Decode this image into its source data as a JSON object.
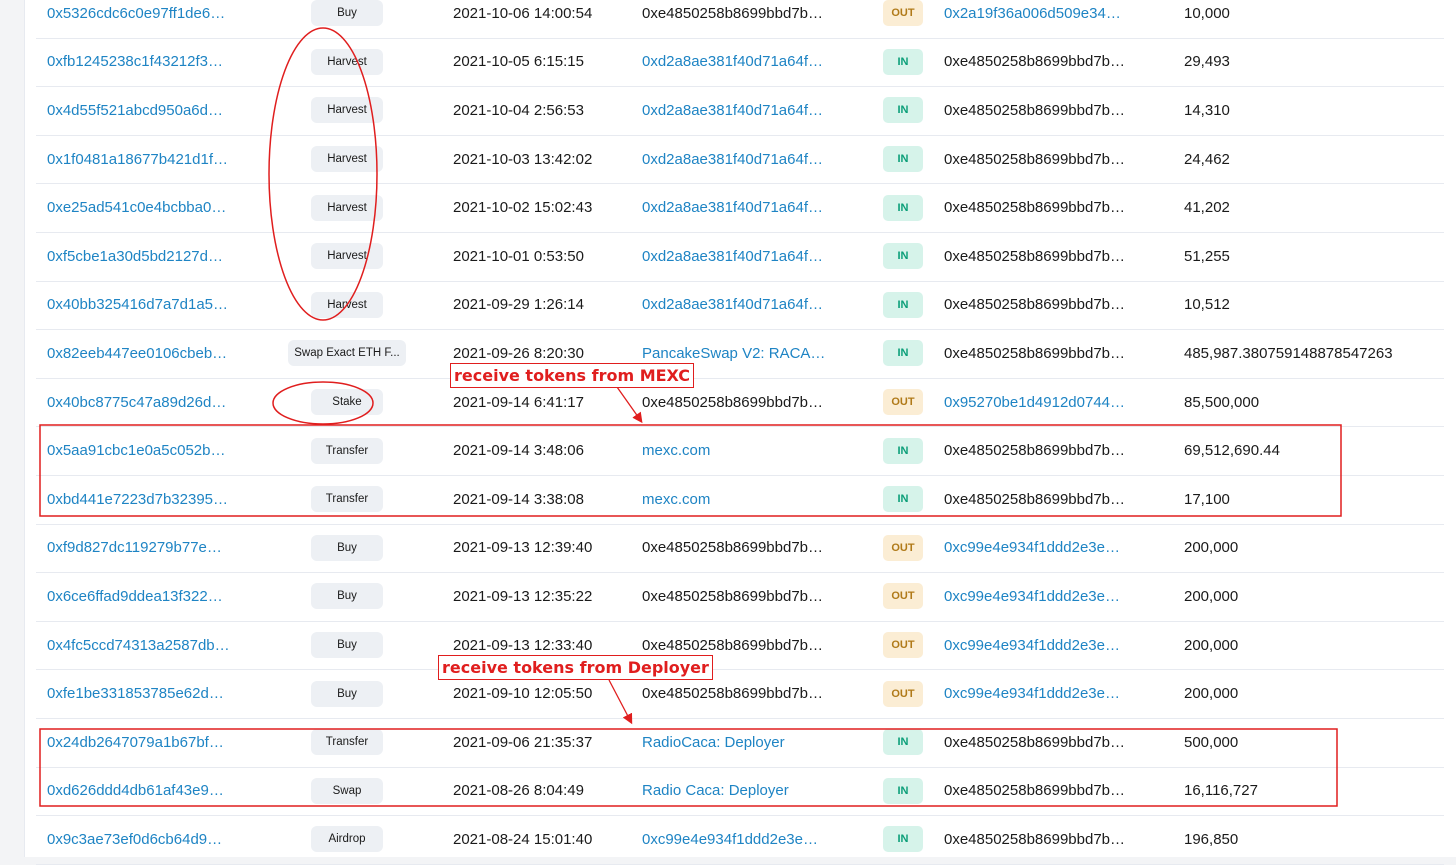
{
  "rows": [
    {
      "hash": "0x5326cdc6c0e97ff1de6…",
      "method": "Buy",
      "time": "2021-10-06 14:00:54",
      "from": "0xe4850258b8699bbd7b…",
      "from_link": false,
      "dir": "OUT",
      "to": "0x2a19f36a006d509e34…",
      "to_link": true,
      "amount": "10,000"
    },
    {
      "hash": "0xfb1245238c1f43212f3…",
      "method": "Harvest",
      "time": "2021-10-05 6:15:15",
      "from": "0xd2a8ae381f40d71a64f…",
      "from_link": true,
      "dir": "IN",
      "to": "0xe4850258b8699bbd7b…",
      "to_link": false,
      "amount": "29,493"
    },
    {
      "hash": "0x4d55f521abcd950a6d…",
      "method": "Harvest",
      "time": "2021-10-04 2:56:53",
      "from": "0xd2a8ae381f40d71a64f…",
      "from_link": true,
      "dir": "IN",
      "to": "0xe4850258b8699bbd7b…",
      "to_link": false,
      "amount": "14,310"
    },
    {
      "hash": "0x1f0481a18677b421d1f…",
      "method": "Harvest",
      "time": "2021-10-03 13:42:02",
      "from": "0xd2a8ae381f40d71a64f…",
      "from_link": true,
      "dir": "IN",
      "to": "0xe4850258b8699bbd7b…",
      "to_link": false,
      "amount": "24,462"
    },
    {
      "hash": "0xe25ad541c0e4bcbba0…",
      "method": "Harvest",
      "time": "2021-10-02 15:02:43",
      "from": "0xd2a8ae381f40d71a64f…",
      "from_link": true,
      "dir": "IN",
      "to": "0xe4850258b8699bbd7b…",
      "to_link": false,
      "amount": "41,202"
    },
    {
      "hash": "0xf5cbe1a30d5bd2127d…",
      "method": "Harvest",
      "time": "2021-10-01 0:53:50",
      "from": "0xd2a8ae381f40d71a64f…",
      "from_link": true,
      "dir": "IN",
      "to": "0xe4850258b8699bbd7b…",
      "to_link": false,
      "amount": "51,255"
    },
    {
      "hash": "0x40bb325416d7a7d1a5…",
      "method": "Harvest",
      "time": "2021-09-29 1:26:14",
      "from": "0xd2a8ae381f40d71a64f…",
      "from_link": true,
      "dir": "IN",
      "to": "0xe4850258b8699bbd7b…",
      "to_link": false,
      "amount": "10,512"
    },
    {
      "hash": "0x82eeb447ee0106cbeb…",
      "method": "Swap Exact ETH F...",
      "time": "2021-09-26 8:20:30",
      "from": "PancakeSwap V2: RACA…",
      "from_link": true,
      "dir": "IN",
      "to": "0xe4850258b8699bbd7b…",
      "to_link": false,
      "amount": "485,987.380759148878547263"
    },
    {
      "hash": "0x40bc8775c47a89d26d…",
      "method": "Stake",
      "time": "2021-09-14 6:41:17",
      "from": "0xe4850258b8699bbd7b…",
      "from_link": false,
      "dir": "OUT",
      "to": "0x95270be1d4912d0744…",
      "to_link": true,
      "amount": "85,500,000"
    },
    {
      "hash": "0x5aa91cbc1e0a5c052b…",
      "method": "Transfer",
      "time": "2021-09-14 3:48:06",
      "from": "mexc.com",
      "from_link": true,
      "dir": "IN",
      "to": "0xe4850258b8699bbd7b…",
      "to_link": false,
      "amount": "69,512,690.44"
    },
    {
      "hash": "0xbd441e7223d7b32395…",
      "method": "Transfer",
      "time": "2021-09-14 3:38:08",
      "from": "mexc.com",
      "from_link": true,
      "dir": "IN",
      "to": "0xe4850258b8699bbd7b…",
      "to_link": false,
      "amount": "17,100"
    },
    {
      "hash": "0xf9d827dc119279b77e…",
      "method": "Buy",
      "time": "2021-09-13 12:39:40",
      "from": "0xe4850258b8699bbd7b…",
      "from_link": false,
      "dir": "OUT",
      "to": "0xc99e4e934f1ddd2e3e…",
      "to_link": true,
      "amount": "200,000"
    },
    {
      "hash": "0x6ce6ffad9ddea13f322…",
      "method": "Buy",
      "time": "2021-09-13 12:35:22",
      "from": "0xe4850258b8699bbd7b…",
      "from_link": false,
      "dir": "OUT",
      "to": "0xc99e4e934f1ddd2e3e…",
      "to_link": true,
      "amount": "200,000"
    },
    {
      "hash": "0x4fc5ccd74313a2587db…",
      "method": "Buy",
      "time": "2021-09-13 12:33:40",
      "from": "0xe4850258b8699bbd7b…",
      "from_link": false,
      "dir": "OUT",
      "to": "0xc99e4e934f1ddd2e3e…",
      "to_link": true,
      "amount": "200,000"
    },
    {
      "hash": "0xfe1be331853785e62d…",
      "method": "Buy",
      "time": "2021-09-10 12:05:50",
      "from": "0xe4850258b8699bbd7b…",
      "from_link": false,
      "dir": "OUT",
      "to": "0xc99e4e934f1ddd2e3e…",
      "to_link": true,
      "amount": "200,000"
    },
    {
      "hash": "0x24db2647079a1b67bf…",
      "method": "Transfer",
      "time": "2021-09-06 21:35:37",
      "from": "RadioCaca: Deployer",
      "from_link": true,
      "dir": "IN",
      "to": "0xe4850258b8699bbd7b…",
      "to_link": false,
      "amount": "500,000"
    },
    {
      "hash": "0xd626ddd4db61af43e9…",
      "method": "Swap",
      "time": "2021-08-26 8:04:49",
      "from": "Radio Caca: Deployer",
      "from_link": true,
      "dir": "IN",
      "to": "0xe4850258b8699bbd7b…",
      "to_link": false,
      "amount": "16,116,727"
    },
    {
      "hash": "0x9c3ae73ef0d6cb64d9…",
      "method": "Airdrop",
      "time": "2021-08-24 15:01:40",
      "from": "0xc99e4e934f1ddd2e3e…",
      "from_link": true,
      "dir": "IN",
      "to": "0xe4850258b8699bbd7b…",
      "to_link": false,
      "amount": "196,850"
    }
  ],
  "annotations": {
    "mexc_note": "receive tokens from MEXC",
    "deployer_note": "receive tokens from Deployer",
    "color": "#e01e1e"
  },
  "colors": {
    "link": "#1e84c4",
    "in_badge_bg": "#d6f3ea",
    "in_badge_text": "#0a9e78",
    "out_badge_bg": "#fbedd4",
    "out_badge_text": "#b07a19",
    "method_pill_bg": "#edf0f4"
  }
}
